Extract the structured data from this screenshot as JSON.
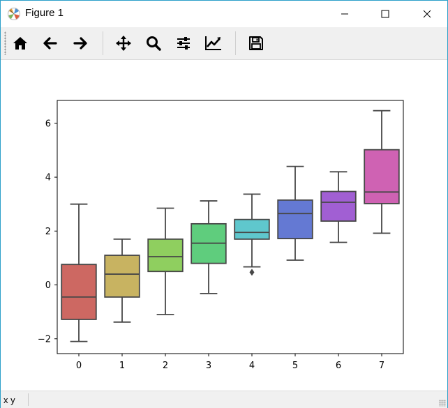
{
  "window": {
    "title": "Figure 1"
  },
  "toolbar": {
    "tools": [
      {
        "name": "home",
        "icon": "home-icon"
      },
      {
        "name": "back",
        "icon": "arrow-left-icon"
      },
      {
        "name": "forward",
        "icon": "arrow-right-icon"
      },
      {
        "name": "pan",
        "icon": "move-icon"
      },
      {
        "name": "zoom",
        "icon": "magnifier-icon"
      },
      {
        "name": "configure-subplots",
        "icon": "sliders-icon"
      },
      {
        "name": "edit-axes",
        "icon": "line-chart-icon"
      },
      {
        "name": "save",
        "icon": "floppy-disk-icon"
      }
    ]
  },
  "status": {
    "coords": "x y"
  },
  "chart_data": {
    "type": "box",
    "title": "",
    "xlabel": "",
    "ylabel": "",
    "categories": [
      "0",
      "1",
      "2",
      "3",
      "4",
      "5",
      "6",
      "7"
    ],
    "ylim": [
      -2.55,
      6.85
    ],
    "yticks": [
      -2,
      0,
      2,
      4,
      6
    ],
    "grid": false,
    "boxes": [
      {
        "category": "0",
        "whisker_low": -2.1,
        "q1": -1.28,
        "median": -0.45,
        "q3": 0.76,
        "whisker_high": 3.0,
        "outliers": [],
        "color": "#cd6862"
      },
      {
        "category": "1",
        "whisker_low": -1.38,
        "q1": -0.45,
        "median": 0.4,
        "q3": 1.1,
        "whisker_high": 1.7,
        "outliers": [],
        "color": "#c8b361"
      },
      {
        "category": "2",
        "whisker_low": -1.1,
        "q1": 0.5,
        "median": 1.05,
        "q3": 1.7,
        "whisker_high": 2.85,
        "outliers": [],
        "color": "#8fcf5f"
      },
      {
        "category": "3",
        "whisker_low": -0.32,
        "q1": 0.8,
        "median": 1.55,
        "q3": 2.27,
        "whisker_high": 3.12,
        "outliers": [],
        "color": "#5fcd7d"
      },
      {
        "category": "4",
        "whisker_low": 0.67,
        "q1": 1.7,
        "median": 1.95,
        "q3": 2.43,
        "whisker_high": 3.37,
        "outliers": [
          0.47
        ],
        "color": "#5fc7cd"
      },
      {
        "category": "5",
        "whisker_low": 0.92,
        "q1": 1.72,
        "median": 2.65,
        "q3": 3.15,
        "whisker_high": 4.4,
        "outliers": [],
        "color": "#6479d3"
      },
      {
        "category": "6",
        "whisker_low": 1.58,
        "q1": 2.37,
        "median": 3.07,
        "q3": 3.47,
        "whisker_high": 4.2,
        "outliers": [],
        "color": "#a15fd3"
      },
      {
        "category": "7",
        "whisker_low": 1.92,
        "q1": 3.02,
        "median": 3.45,
        "q3": 5.02,
        "whisker_high": 6.47,
        "outliers": [],
        "color": "#cf62b3"
      }
    ],
    "line_color": "#474747"
  }
}
